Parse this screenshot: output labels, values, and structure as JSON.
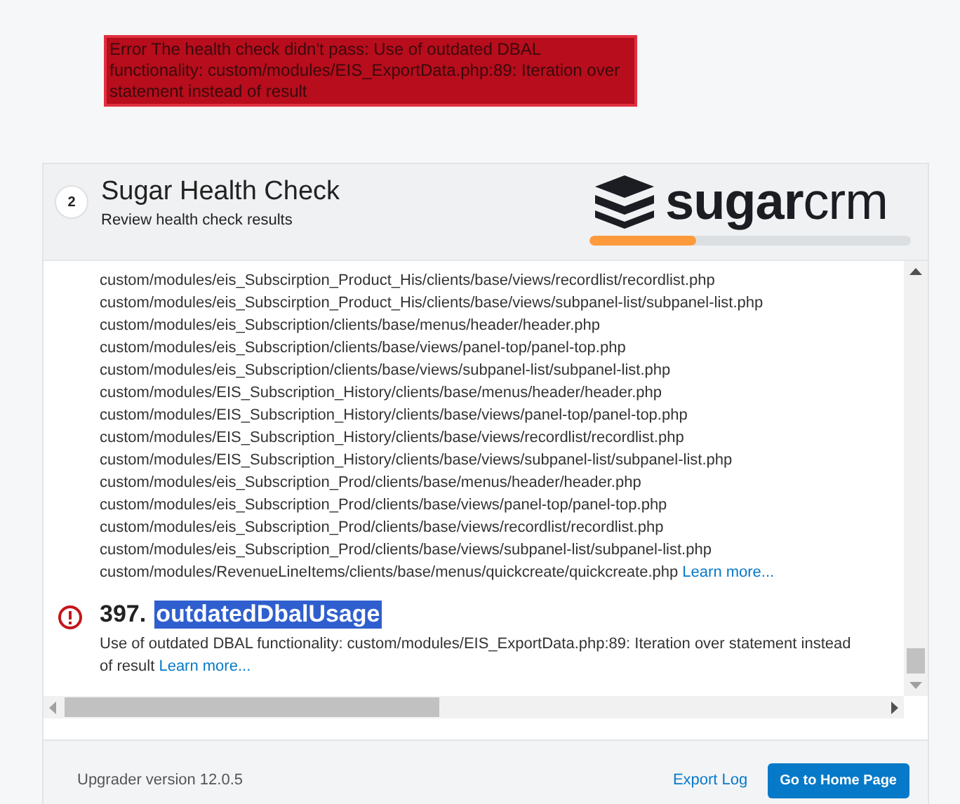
{
  "error_banner": {
    "text": "Error The health check didn't pass: Use of outdated DBAL functionality: custom/modules/EIS_ExportData.php:89: Iteration over statement instead of result"
  },
  "wizard": {
    "step": "2",
    "title": "Sugar Health Check",
    "subtitle": "Review health check results",
    "logo": {
      "bold": "sugar",
      "light": "crm"
    },
    "progress": {
      "level": 0.33
    }
  },
  "results": {
    "files": [
      "custom/modules/eis_Subscirption_Product_His/clients/base/views/recordlist/recordlist.php",
      "custom/modules/eis_Subscirption_Product_His/clients/base/views/subpanel-list/subpanel-list.php",
      "custom/modules/eis_Subscription/clients/base/menus/header/header.php",
      "custom/modules/eis_Subscription/clients/base/views/panel-top/panel-top.php",
      "custom/modules/eis_Subscription/clients/base/views/subpanel-list/subpanel-list.php",
      "custom/modules/EIS_Subscription_History/clients/base/menus/header/header.php",
      "custom/modules/EIS_Subscription_History/clients/base/views/panel-top/panel-top.php",
      "custom/modules/EIS_Subscription_History/clients/base/views/recordlist/recordlist.php",
      "custom/modules/EIS_Subscription_History/clients/base/views/subpanel-list/subpanel-list.php",
      "custom/modules/eis_Subscription_Prod/clients/base/menus/header/header.php",
      "custom/modules/eis_Subscription_Prod/clients/base/views/panel-top/panel-top.php",
      "custom/modules/eis_Subscription_Prod/clients/base/views/recordlist/recordlist.php",
      "custom/modules/eis_Subscription_Prod/clients/base/views/subpanel-list/subpanel-list.php",
      "custom/modules/RevenueLineItems/clients/base/menus/quickcreate/quickcreate.php"
    ],
    "files_link": "Learn more...",
    "issue": {
      "number": "397.",
      "name": "outdatedDbalUsage",
      "selected": true,
      "description": "Use of outdated DBAL functionality: custom/modules/EIS_ExportData.php:89: Iteration over statement instead of result",
      "link": "Learn more..."
    }
  },
  "footer": {
    "version": "Upgrader version 12.0.5",
    "export_link": "Export Log",
    "home_button": "Go to Home Page"
  }
}
